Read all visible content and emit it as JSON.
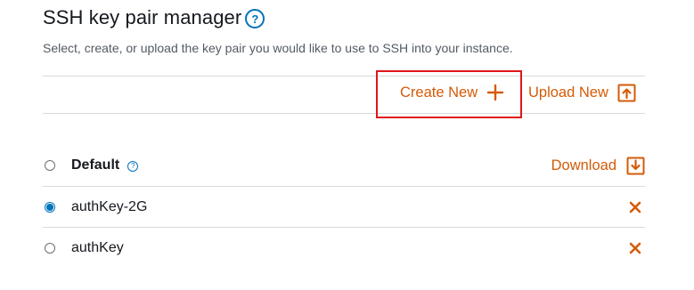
{
  "header": {
    "title": "SSH key pair manager",
    "help_icon": "?",
    "subtitle": "Select, create, or upload the key pair you would like to use to SSH into your instance."
  },
  "actions": {
    "create_new_label": "Create New",
    "upload_new_label": "Upload New"
  },
  "key_pairs": [
    {
      "name": "Default",
      "selected": false,
      "action": "Download",
      "action_icon": "download-icon",
      "help_icon": "?"
    },
    {
      "name": "authKey-2G",
      "selected": true,
      "action_icon": "delete-x-icon"
    },
    {
      "name": "authKey",
      "selected": false,
      "action_icon": "delete-x-icon"
    }
  ],
  "colors": {
    "accent": "#d45b07",
    "link_blue": "#0073bb",
    "highlight": "#e0161c",
    "divider": "#d5dbdb"
  }
}
